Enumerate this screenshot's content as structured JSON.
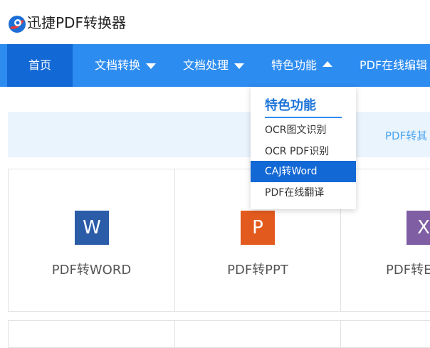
{
  "header": {
    "brand": "迅捷PDF转换器"
  },
  "nav": {
    "items": [
      {
        "label": "首页"
      },
      {
        "label": "文档转换"
      },
      {
        "label": "文档处理"
      },
      {
        "label": "特色功能"
      },
      {
        "label": "PDF在线编辑"
      }
    ]
  },
  "dropdown": {
    "title": "特色功能",
    "items": [
      {
        "label": "OCR图文识别"
      },
      {
        "label": "OCR PDF识别"
      },
      {
        "label": "CAJ转Word",
        "highlighted": true
      },
      {
        "label": "PDF在线翻译"
      }
    ]
  },
  "banner": {
    "text": "PDF转其"
  },
  "tools": [
    {
      "icon_letter": "W",
      "label": "PDF转WORD",
      "color": "#2b5ca8"
    },
    {
      "icon_letter": "P",
      "label": "PDF转PPT",
      "color": "#e35a1e"
    },
    {
      "icon_letter": "X",
      "label": "PDF转E",
      "color": "#7f5ea4"
    }
  ],
  "colors": {
    "nav_bg": "#2d8cf0",
    "nav_active": "#1268d4",
    "banner_bg": "#eaf4fd",
    "dropdown_title": "#1a73d8"
  }
}
